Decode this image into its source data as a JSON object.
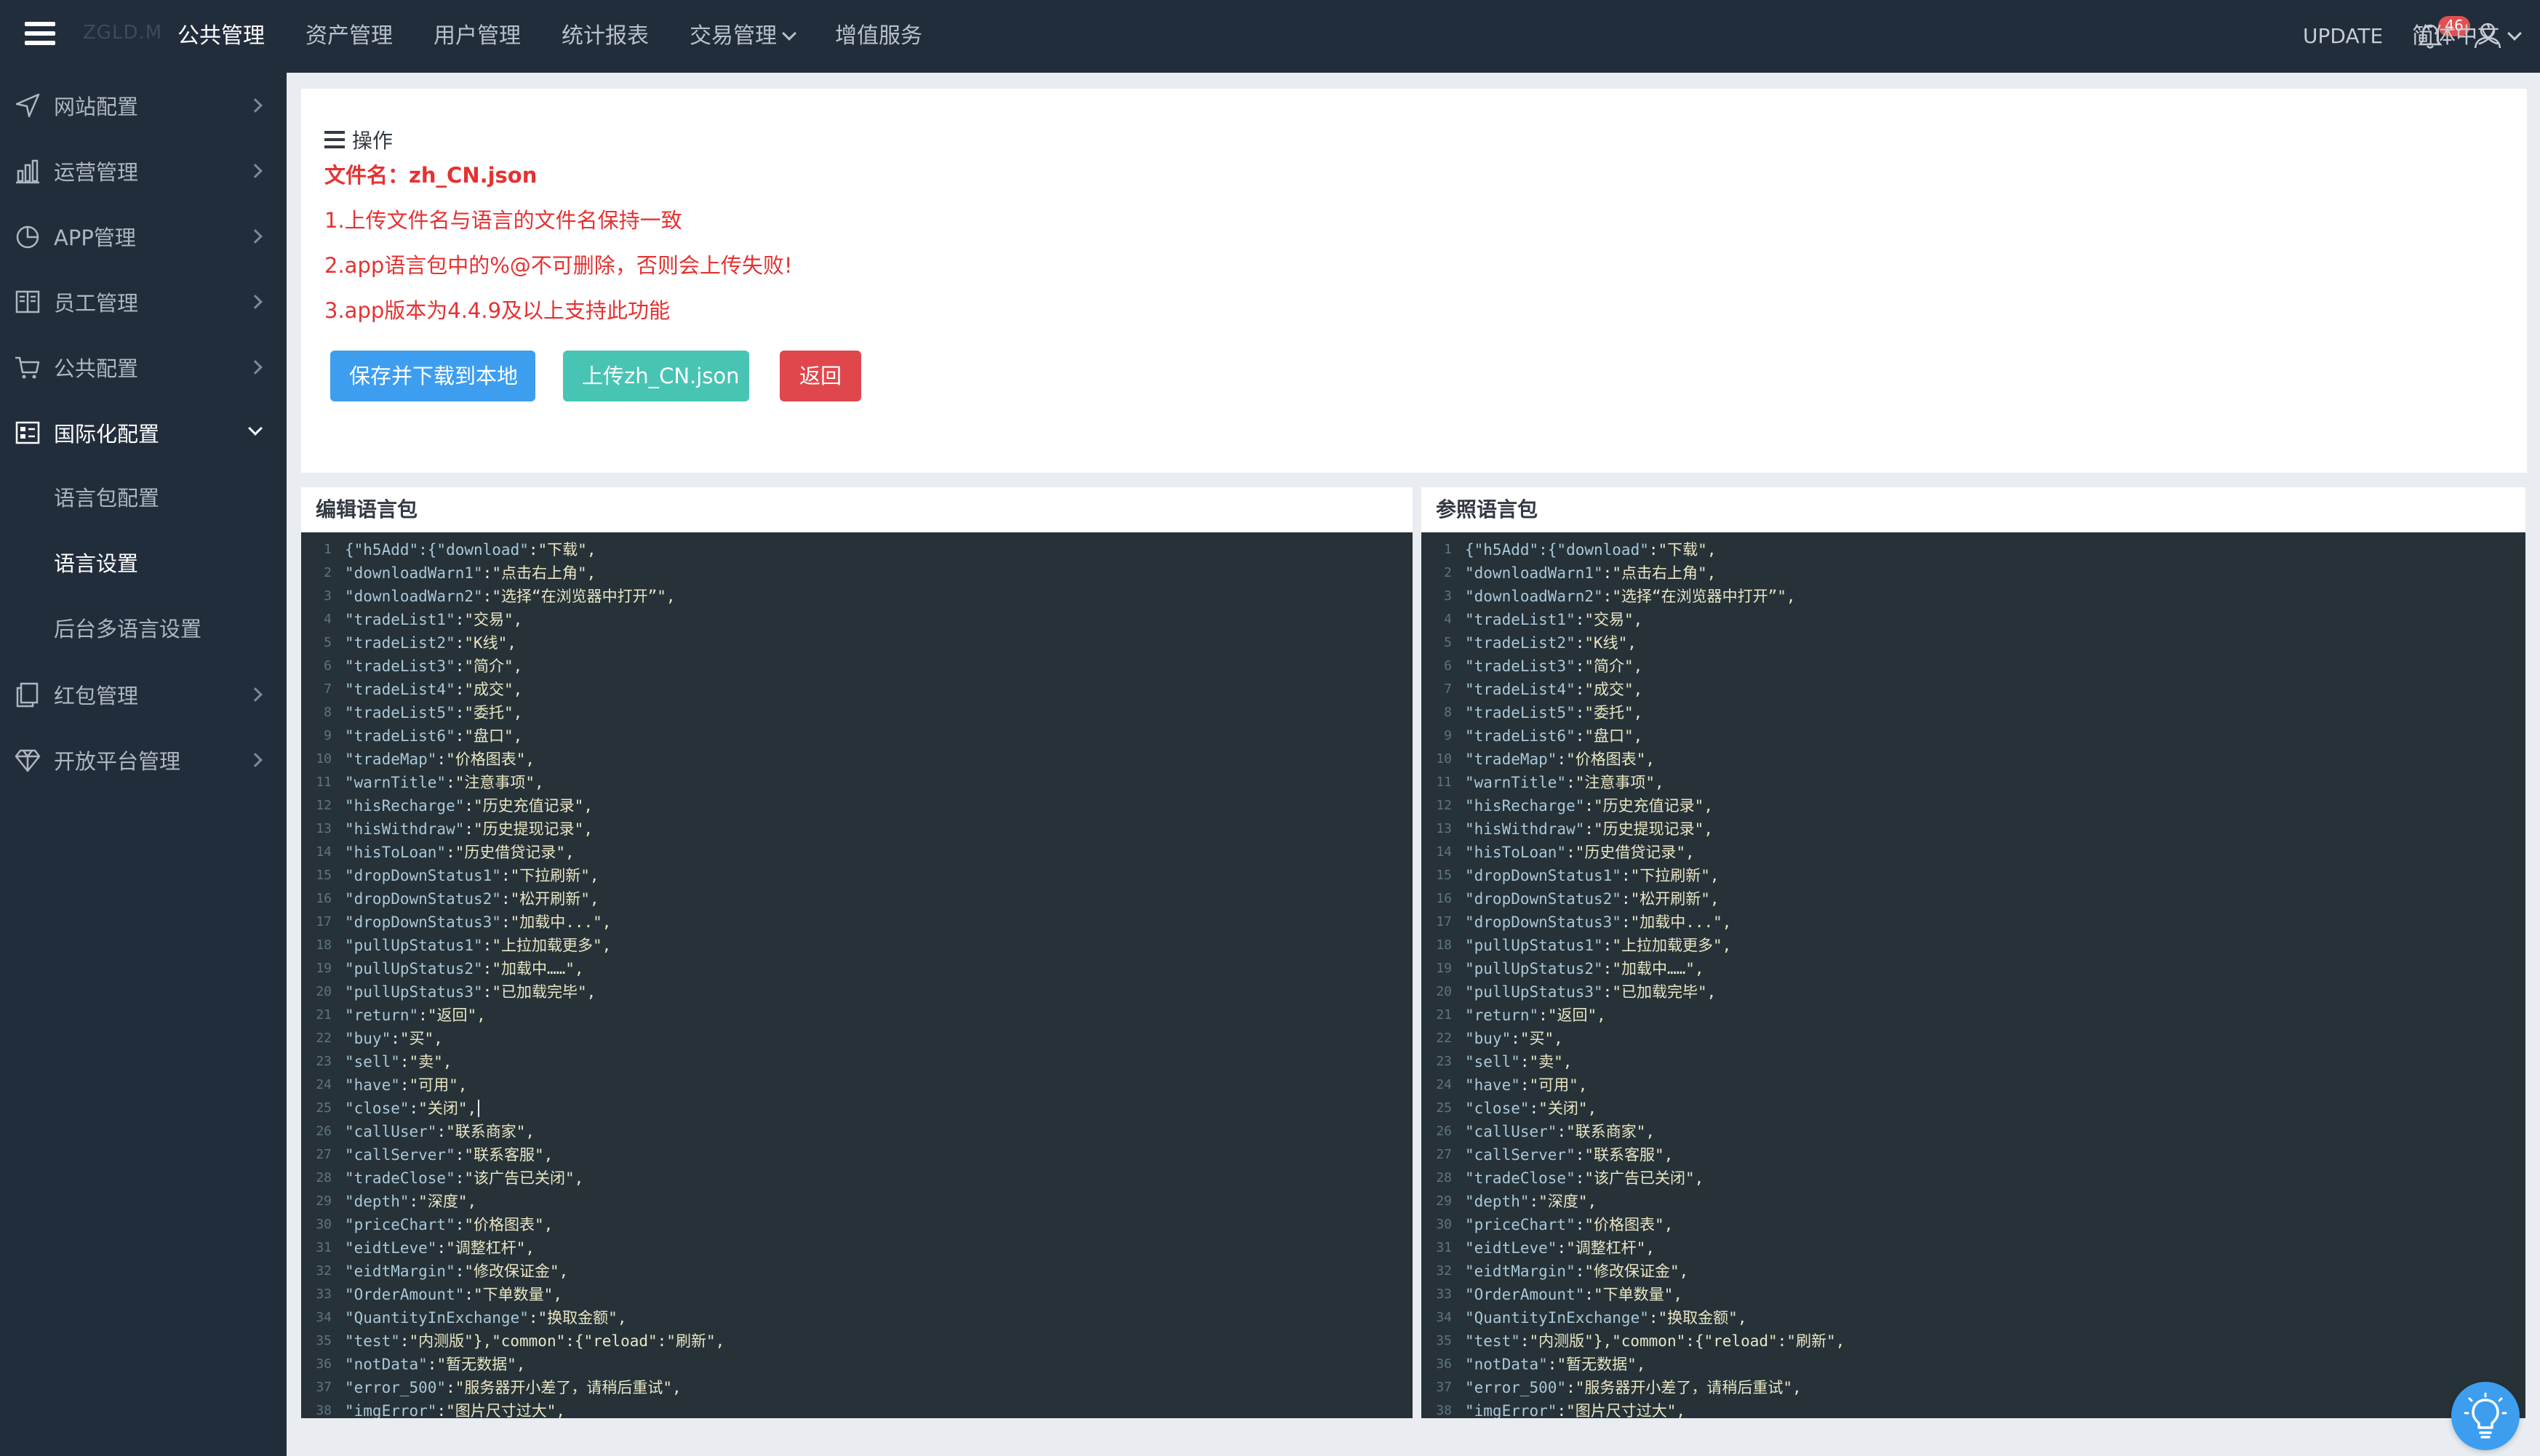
{
  "topbar": {
    "brand": "ZGLD.M",
    "nav": [
      {
        "label": "公共管理",
        "active": true
      },
      {
        "label": "资产管理"
      },
      {
        "label": "用户管理"
      },
      {
        "label": "统计报表"
      },
      {
        "label": "交易管理",
        "dropdown": true
      },
      {
        "label": "增值服务"
      }
    ],
    "update_label": "UPDATE",
    "notification_count": "46",
    "language": "简体中文"
  },
  "sidebar": {
    "items": [
      {
        "label": "网站配置",
        "icon": "send-icon"
      },
      {
        "label": "运营管理",
        "icon": "bar-chart-icon"
      },
      {
        "label": "APP管理",
        "icon": "pie-chart-icon"
      },
      {
        "label": "员工管理",
        "icon": "book-icon"
      },
      {
        "label": "公共配置",
        "icon": "cart-icon"
      },
      {
        "label": "国际化配置",
        "icon": "dashboard-icon",
        "open": true
      },
      {
        "label": "红包管理",
        "icon": "copy-icon"
      },
      {
        "label": "开放平台管理",
        "icon": "diamond-icon"
      }
    ],
    "sub_items": [
      {
        "label": "语言包配置"
      },
      {
        "label": "语言设置",
        "active": true
      },
      {
        "label": "后台多语言设置"
      }
    ]
  },
  "operation": {
    "title": "操作",
    "filename_label": "文件名：",
    "filename": "zh_CN.json",
    "notes": [
      "1.上传文件名与语言的文件名保持一致",
      "2.app语言包中的%@不可删除，否则会上传失败!",
      "3.app版本为4.4.9及以上支持此功能"
    ],
    "buttons": {
      "save": "保存并下载到本地",
      "upload": "上传zh_CN.json",
      "back": "返回"
    }
  },
  "editors": {
    "left_title": "编辑语言包",
    "right_title": "参照语言包",
    "lines": [
      {
        "k": "{\"h5Add\":{\"download\"",
        "v": "\"下载\","
      },
      {
        "k": "\"downloadWarn1\"",
        "v": "\"点击右上角\","
      },
      {
        "k": "\"downloadWarn2\"",
        "v": "\"选择“在浏览器中打开”\","
      },
      {
        "k": "\"tradeList1\"",
        "v": "\"交易\","
      },
      {
        "k": "\"tradeList2\"",
        "v": "\"K线\","
      },
      {
        "k": "\"tradeList3\"",
        "v": "\"简介\","
      },
      {
        "k": "\"tradeList4\"",
        "v": "\"成交\","
      },
      {
        "k": "\"tradeList5\"",
        "v": "\"委托\","
      },
      {
        "k": "\"tradeList6\"",
        "v": "\"盘口\","
      },
      {
        "k": "\"tradeMap\"",
        "v": "\"价格图表\","
      },
      {
        "k": "\"warnTitle\"",
        "v": "\"注意事项\","
      },
      {
        "k": "\"hisRecharge\"",
        "v": "\"历史充值记录\","
      },
      {
        "k": "\"hisWithdraw\"",
        "v": "\"历史提现记录\","
      },
      {
        "k": "\"hisToLoan\"",
        "v": "\"历史借贷记录\","
      },
      {
        "k": "\"dropDownStatus1\"",
        "v": "\"下拉刷新\","
      },
      {
        "k": "\"dropDownStatus2\"",
        "v": "\"松开刷新\","
      },
      {
        "k": "\"dropDownStatus3\"",
        "v": "\"加载中...\","
      },
      {
        "k": "\"pullUpStatus1\"",
        "v": "\"上拉加载更多\","
      },
      {
        "k": "\"pullUpStatus2\"",
        "v": "\"加载中……\","
      },
      {
        "k": "\"pullUpStatus3\"",
        "v": "\"已加载完毕\","
      },
      {
        "k": "\"return\"",
        "v": "\"返回\","
      },
      {
        "k": "\"buy\"",
        "v": "\"买\","
      },
      {
        "k": "\"sell\"",
        "v": "\"卖\","
      },
      {
        "k": "\"have\"",
        "v": "\"可用\","
      },
      {
        "k": "\"close\"",
        "v": "\"关闭\","
      },
      {
        "k": "\"callUser\"",
        "v": "\"联系商家\","
      },
      {
        "k": "\"callServer\"",
        "v": "\"联系客服\","
      },
      {
        "k": "\"tradeClose\"",
        "v": "\"该广告已关闭\","
      },
      {
        "k": "\"depth\"",
        "v": "\"深度\","
      },
      {
        "k": "\"priceChart\"",
        "v": "\"价格图表\","
      },
      {
        "k": "\"eidtLeve\"",
        "v": "\"调整杠杆\","
      },
      {
        "k": "\"eidtMargin\"",
        "v": "\"修改保证金\","
      },
      {
        "k": "\"OrderAmount\"",
        "v": "\"下单数量\","
      },
      {
        "k": "\"QuantityInExchange\"",
        "v": "\"换取金额\","
      },
      {
        "k": "\"test\"",
        "v": "\"内测版\"},\"common\":{\"reload\":\"刷新\","
      },
      {
        "k": "\"notData\"",
        "v": "\"暂无数据\","
      },
      {
        "k": "\"error_500\"",
        "v": "\"服务器开小差了，请稍后重试\","
      },
      {
        "k": "\"imgError\"",
        "v": "\"图片尺寸过大\","
      }
    ]
  },
  "colors": {
    "topbar_bg": "#222d3c",
    "page_bg": "#e9edf2",
    "notice_red": "#e53232",
    "save_blue": "#3d9ef0",
    "upload_teal": "#47c4b4",
    "back_red": "#e0474c",
    "editor_bg": "#263238"
  }
}
